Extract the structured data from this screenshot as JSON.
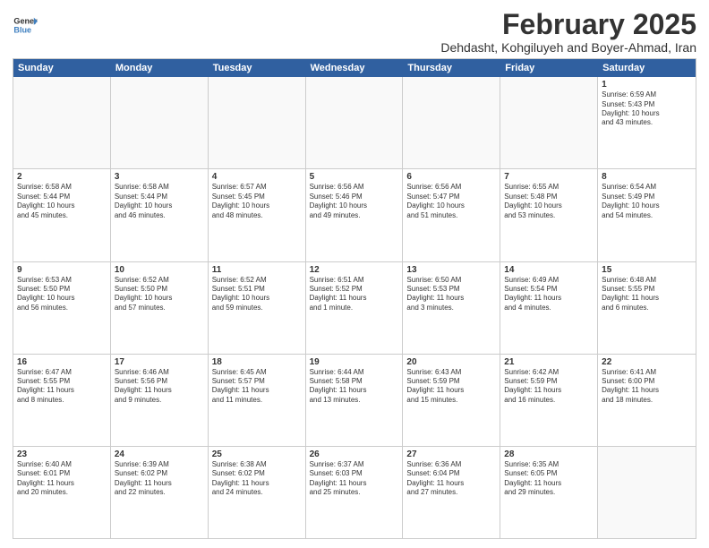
{
  "logo": {
    "line1": "General",
    "line2": "Blue"
  },
  "title": "February 2025",
  "subtitle": "Dehdasht, Kohgiluyeh and Boyer-Ahmad, Iran",
  "header_days": [
    "Sunday",
    "Monday",
    "Tuesday",
    "Wednesday",
    "Thursday",
    "Friday",
    "Saturday"
  ],
  "weeks": [
    [
      {
        "day": "",
        "info": ""
      },
      {
        "day": "",
        "info": ""
      },
      {
        "day": "",
        "info": ""
      },
      {
        "day": "",
        "info": ""
      },
      {
        "day": "",
        "info": ""
      },
      {
        "day": "",
        "info": ""
      },
      {
        "day": "1",
        "info": "Sunrise: 6:59 AM\nSunset: 5:43 PM\nDaylight: 10 hours\nand 43 minutes."
      }
    ],
    [
      {
        "day": "2",
        "info": "Sunrise: 6:58 AM\nSunset: 5:44 PM\nDaylight: 10 hours\nand 45 minutes."
      },
      {
        "day": "3",
        "info": "Sunrise: 6:58 AM\nSunset: 5:44 PM\nDaylight: 10 hours\nand 46 minutes."
      },
      {
        "day": "4",
        "info": "Sunrise: 6:57 AM\nSunset: 5:45 PM\nDaylight: 10 hours\nand 48 minutes."
      },
      {
        "day": "5",
        "info": "Sunrise: 6:56 AM\nSunset: 5:46 PM\nDaylight: 10 hours\nand 49 minutes."
      },
      {
        "day": "6",
        "info": "Sunrise: 6:56 AM\nSunset: 5:47 PM\nDaylight: 10 hours\nand 51 minutes."
      },
      {
        "day": "7",
        "info": "Sunrise: 6:55 AM\nSunset: 5:48 PM\nDaylight: 10 hours\nand 53 minutes."
      },
      {
        "day": "8",
        "info": "Sunrise: 6:54 AM\nSunset: 5:49 PM\nDaylight: 10 hours\nand 54 minutes."
      }
    ],
    [
      {
        "day": "9",
        "info": "Sunrise: 6:53 AM\nSunset: 5:50 PM\nDaylight: 10 hours\nand 56 minutes."
      },
      {
        "day": "10",
        "info": "Sunrise: 6:52 AM\nSunset: 5:50 PM\nDaylight: 10 hours\nand 57 minutes."
      },
      {
        "day": "11",
        "info": "Sunrise: 6:52 AM\nSunset: 5:51 PM\nDaylight: 10 hours\nand 59 minutes."
      },
      {
        "day": "12",
        "info": "Sunrise: 6:51 AM\nSunset: 5:52 PM\nDaylight: 11 hours\nand 1 minute."
      },
      {
        "day": "13",
        "info": "Sunrise: 6:50 AM\nSunset: 5:53 PM\nDaylight: 11 hours\nand 3 minutes."
      },
      {
        "day": "14",
        "info": "Sunrise: 6:49 AM\nSunset: 5:54 PM\nDaylight: 11 hours\nand 4 minutes."
      },
      {
        "day": "15",
        "info": "Sunrise: 6:48 AM\nSunset: 5:55 PM\nDaylight: 11 hours\nand 6 minutes."
      }
    ],
    [
      {
        "day": "16",
        "info": "Sunrise: 6:47 AM\nSunset: 5:55 PM\nDaylight: 11 hours\nand 8 minutes."
      },
      {
        "day": "17",
        "info": "Sunrise: 6:46 AM\nSunset: 5:56 PM\nDaylight: 11 hours\nand 9 minutes."
      },
      {
        "day": "18",
        "info": "Sunrise: 6:45 AM\nSunset: 5:57 PM\nDaylight: 11 hours\nand 11 minutes."
      },
      {
        "day": "19",
        "info": "Sunrise: 6:44 AM\nSunset: 5:58 PM\nDaylight: 11 hours\nand 13 minutes."
      },
      {
        "day": "20",
        "info": "Sunrise: 6:43 AM\nSunset: 5:59 PM\nDaylight: 11 hours\nand 15 minutes."
      },
      {
        "day": "21",
        "info": "Sunrise: 6:42 AM\nSunset: 5:59 PM\nDaylight: 11 hours\nand 16 minutes."
      },
      {
        "day": "22",
        "info": "Sunrise: 6:41 AM\nSunset: 6:00 PM\nDaylight: 11 hours\nand 18 minutes."
      }
    ],
    [
      {
        "day": "23",
        "info": "Sunrise: 6:40 AM\nSunset: 6:01 PM\nDaylight: 11 hours\nand 20 minutes."
      },
      {
        "day": "24",
        "info": "Sunrise: 6:39 AM\nSunset: 6:02 PM\nDaylight: 11 hours\nand 22 minutes."
      },
      {
        "day": "25",
        "info": "Sunrise: 6:38 AM\nSunset: 6:02 PM\nDaylight: 11 hours\nand 24 minutes."
      },
      {
        "day": "26",
        "info": "Sunrise: 6:37 AM\nSunset: 6:03 PM\nDaylight: 11 hours\nand 25 minutes."
      },
      {
        "day": "27",
        "info": "Sunrise: 6:36 AM\nSunset: 6:04 PM\nDaylight: 11 hours\nand 27 minutes."
      },
      {
        "day": "28",
        "info": "Sunrise: 6:35 AM\nSunset: 6:05 PM\nDaylight: 11 hours\nand 29 minutes."
      },
      {
        "day": "",
        "info": ""
      }
    ]
  ]
}
